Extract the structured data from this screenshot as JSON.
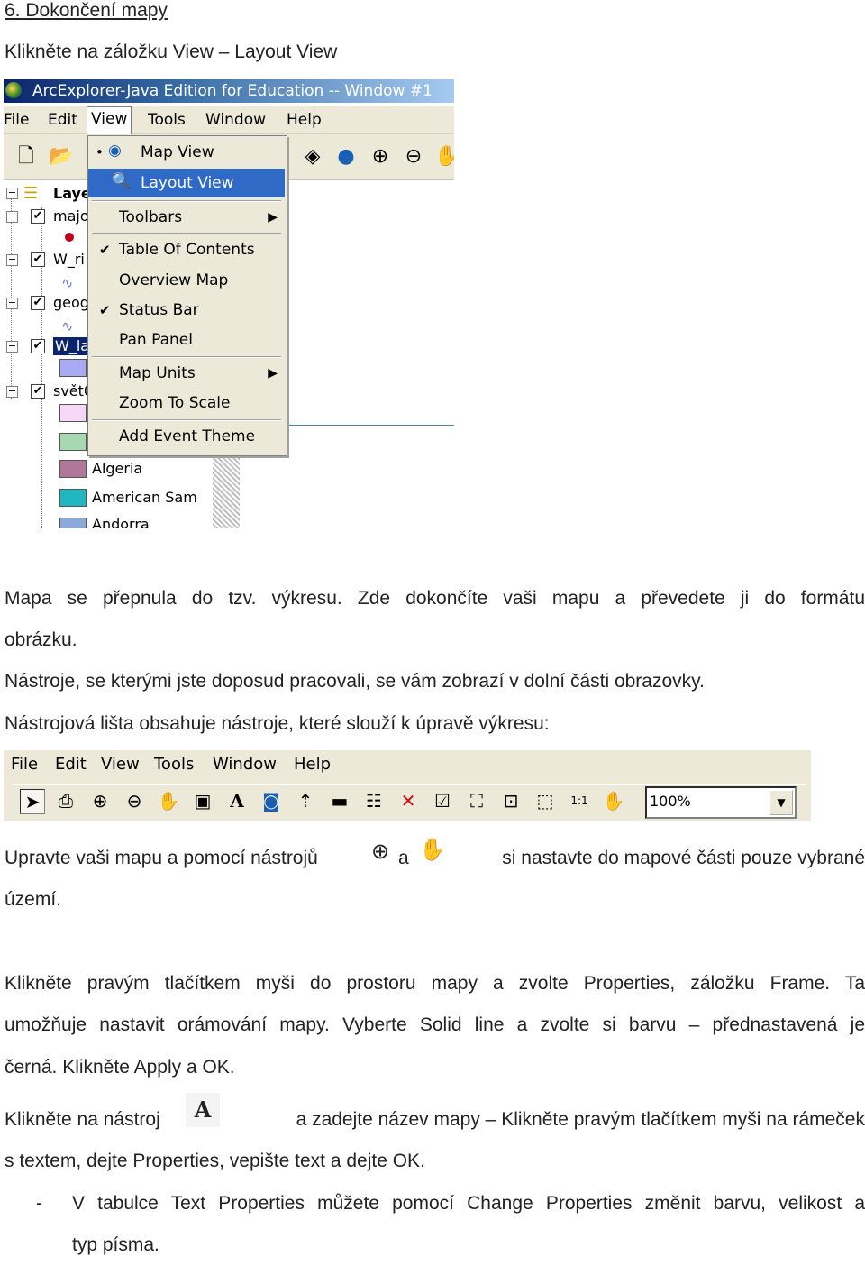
{
  "heading": "6. Dokončení mapy",
  "intro": "Klikněte na záložku View – Layout View",
  "screenshot1": {
    "window_title": "ArcExplorer-Java Edition for Education -- Window #1",
    "menu": [
      "File",
      "Edit",
      "View",
      "Tools",
      "Window",
      "Help"
    ],
    "layers": [
      "Laye",
      "majo",
      "W_ri",
      "geog",
      "W_la",
      "svět0"
    ],
    "legend": [
      "Algeria",
      "American Sam",
      "Andorra"
    ],
    "view_menu": [
      {
        "label": "Map View",
        "mark": "•",
        "icon": "map-view-icon"
      },
      {
        "label": "Layout View",
        "selected": true,
        "icon": "layout-view-icon"
      },
      {
        "label": "Toolbars",
        "submenu": true
      },
      {
        "label": "Table Of Contents",
        "mark": "✔"
      },
      {
        "label": "Overview Map"
      },
      {
        "label": "Status Bar",
        "mark": "✔"
      },
      {
        "label": "Pan Panel"
      },
      {
        "label": "Map Units",
        "submenu": true
      },
      {
        "label": "Zoom To Scale"
      },
      {
        "label": "Add Event Theme"
      }
    ],
    "colors": {
      "selection": "#3169c6",
      "menu_bg": "#ece9d8"
    }
  },
  "para1": "Mapa se přepnula do tzv. výkresu. Zde dokončíte vaši mapu a převedete ji do formátu",
  "para1b": "obrázku.",
  "para2": "Nástroje, se kterými jste doposud pracovali, se vám zobrazí v dolní části obrazovky.",
  "para3": "Nástrojová lišta obsahuje nástroje, které slouží k úpravě výkresu:",
  "screenshot2": {
    "menu": [
      "File",
      "Edit",
      "View",
      "Tools",
      "Window",
      "Help"
    ],
    "zoom_value": "100%"
  },
  "para4": {
    "part1": "Upravte vaši mapu a pomocí nástrojů",
    "part2": "a",
    "part3": "si nastavte do mapové části pouze vybrané",
    "part4": "území."
  },
  "para5": {
    "line1": "Klikněte pravým tlačítkem myši do prostoru mapy a zvolte Properties, záložku Frame. Ta",
    "line2": "umožňuje nastavit orámování mapy. Vyberte Solid line a zvolte si barvu – přednastavená je",
    "line3": "černá. Klikněte Apply a OK."
  },
  "para6": {
    "part1": "Klikněte na nástroj",
    "part2": "a zadejte název mapy – Klikněte pravým tlačítkem myši na rámeček",
    "line2": "s textem, dejte Properties, vepište text a dejte OK."
  },
  "bullet": {
    "dash": "-",
    "line1": "V tabulce Text Properties můžete pomocí Change Properties změnit barvu, velikost a",
    "line2": "typ písma."
  }
}
